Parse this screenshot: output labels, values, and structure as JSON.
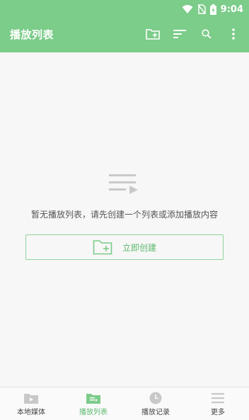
{
  "status": {
    "time": "9:04"
  },
  "appbar": {
    "title": "播放列表",
    "actions": [
      {
        "name": "new-folder-icon"
      },
      {
        "name": "sort-icon"
      },
      {
        "name": "search-icon"
      },
      {
        "name": "more-vert-icon"
      }
    ]
  },
  "empty_state": {
    "icon": "playlist-icon",
    "message": "暂无播放列表，请先创建一个列表或添加播放内容",
    "button_label": "立即创建"
  },
  "bottom_nav": {
    "active_index": 1,
    "items": [
      {
        "label": "本地媒体",
        "icon": "folder-play-icon"
      },
      {
        "label": "播放列表",
        "icon": "playlist-folder-icon"
      },
      {
        "label": "播放记录",
        "icon": "clock-icon"
      },
      {
        "label": "更多",
        "icon": "menu-icon"
      }
    ]
  },
  "colors": {
    "accent": "#7ccc8a",
    "accent_text": "#5cb96c",
    "inactive_icon": "#c8c8c8"
  }
}
